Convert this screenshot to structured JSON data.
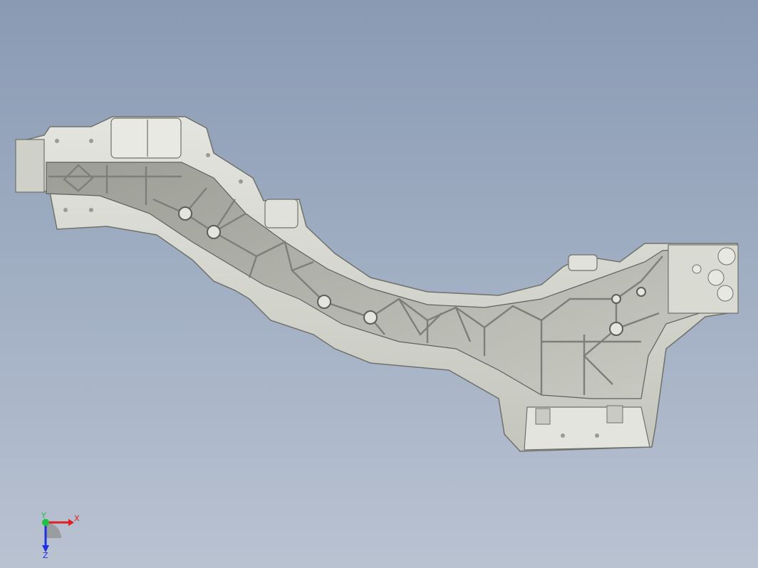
{
  "viewport": {
    "background_top": "#8a9ab3",
    "background_bottom": "#b9c2d1"
  },
  "model": {
    "fill": "#d6d7cf",
    "shade": "#b5b7ad",
    "rib_color": "#8c8e86",
    "edge_color": "#6f716b"
  },
  "triad": {
    "x_label": "X",
    "y_label": "Y",
    "z_label": "Z",
    "x_color": "#e02020",
    "y_color": "#20c040",
    "z_color": "#2030e0"
  }
}
